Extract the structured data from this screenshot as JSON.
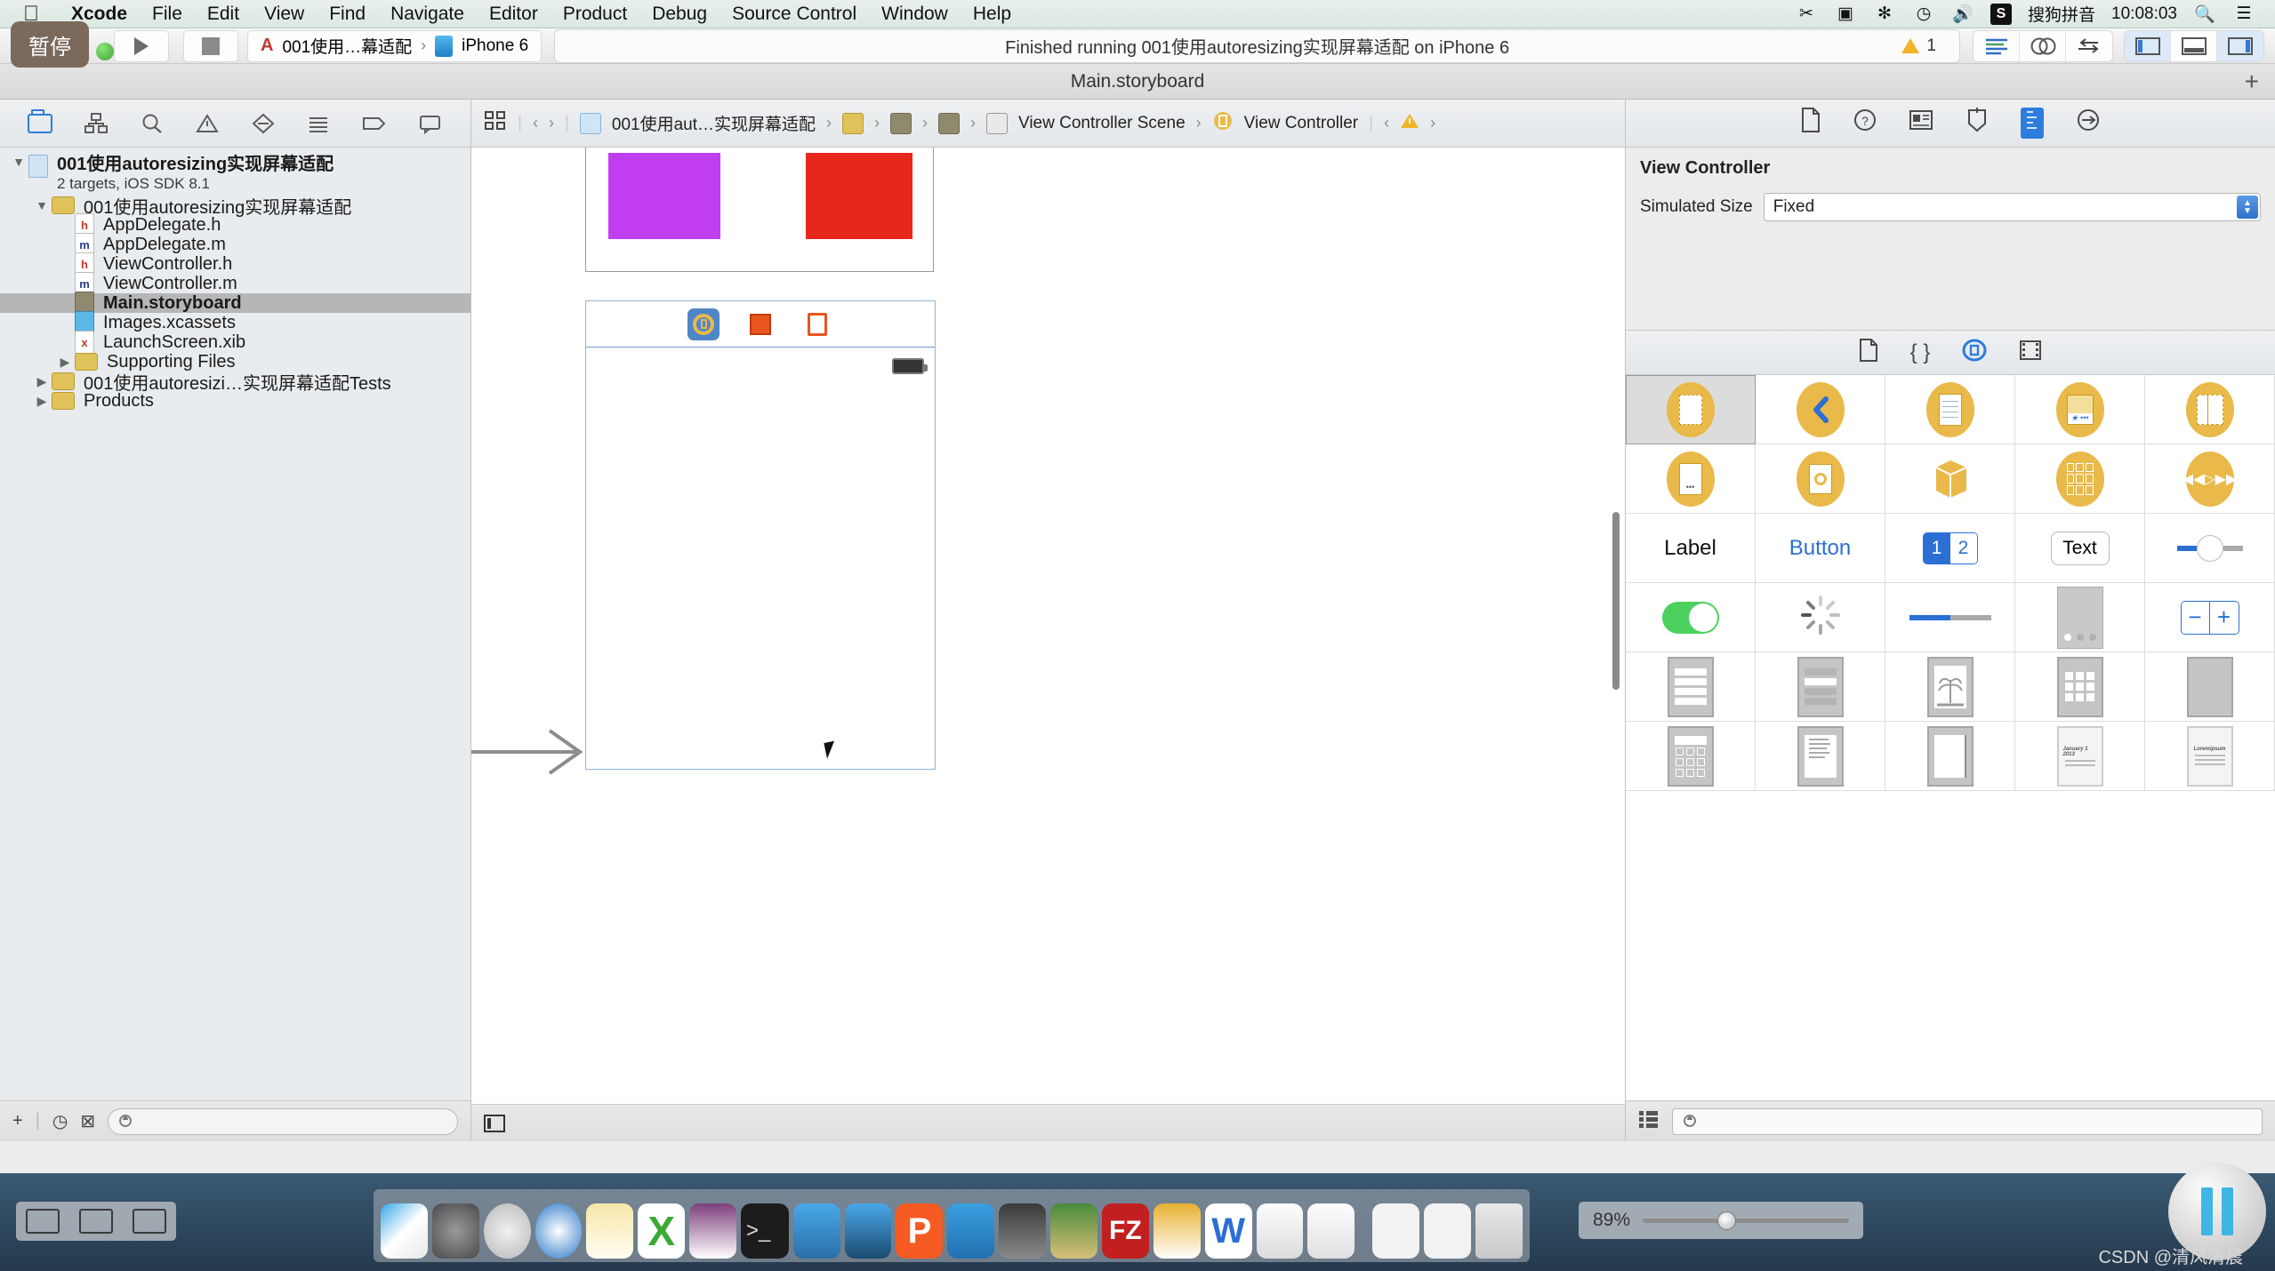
{
  "menubar": {
    "apple": "",
    "items": [
      "Xcode",
      "File",
      "Edit",
      "View",
      "Find",
      "Navigate",
      "Editor",
      "Product",
      "Debug",
      "Source Control",
      "Window",
      "Help"
    ],
    "status": {
      "scissors_icon": "✂",
      "screen_icon": "▣",
      "bluetooth_icon": "✻",
      "timemachine_icon": "◷",
      "volume_icon": "🔊",
      "input_badge": "S",
      "input_name": "搜狗拼音",
      "clock": "10:08:03",
      "search_icon": "🔍",
      "menu_icon": "☰"
    }
  },
  "toolbar": {
    "pause_label": "暂停",
    "run_tooltip": "Run",
    "stop_tooltip": "Stop",
    "scheme_project": "001使用…幕适配",
    "scheme_separator": "›",
    "scheme_destination": "iPhone 6",
    "activity_text": "Finished running 001使用autoresizing实现屏幕适配 on iPhone 6",
    "warning_count": "1",
    "editor_segments": [
      "standard-editor",
      "assistant-editor",
      "version-editor"
    ],
    "view_segments": [
      "navigator-toggle",
      "debug-area-toggle",
      "utilities-toggle"
    ]
  },
  "tabstrip": {
    "title": "Main.storyboard",
    "add_tab": "+"
  },
  "navigator": {
    "tabs": [
      "project-navigator",
      "symbol-navigator",
      "find-navigator",
      "issue-navigator",
      "test-navigator",
      "debug-navigator",
      "breakpoint-navigator",
      "report-navigator"
    ],
    "tree": [
      {
        "name": "001使用autoresizing实现屏幕适配",
        "sub": "2 targets, iOS SDK 8.1",
        "icon": "project",
        "twisty": "▼",
        "indent": 0,
        "bold": true,
        "selected": false
      },
      {
        "name": "001使用autoresizing实现屏幕适配",
        "sub": "",
        "icon": "folder",
        "twisty": "▼",
        "indent": 1,
        "bold": false,
        "selected": false
      },
      {
        "name": "AppDelegate.h",
        "sub": "",
        "icon": "h",
        "twisty": "",
        "indent": 2,
        "bold": false,
        "selected": false
      },
      {
        "name": "AppDelegate.m",
        "sub": "",
        "icon": "m",
        "twisty": "",
        "indent": 2,
        "bold": false,
        "selected": false
      },
      {
        "name": "ViewController.h",
        "sub": "",
        "icon": "h",
        "twisty": "",
        "indent": 2,
        "bold": false,
        "selected": false
      },
      {
        "name": "ViewController.m",
        "sub": "",
        "icon": "m",
        "twisty": "",
        "indent": 2,
        "bold": false,
        "selected": false
      },
      {
        "name": "Main.storyboard",
        "sub": "",
        "icon": "sb",
        "twisty": "",
        "indent": 2,
        "bold": true,
        "selected": true
      },
      {
        "name": "Images.xcassets",
        "sub": "",
        "icon": "xc",
        "twisty": "",
        "indent": 2,
        "bold": false,
        "selected": false
      },
      {
        "name": "LaunchScreen.xib",
        "sub": "",
        "icon": "xib",
        "twisty": "",
        "indent": 2,
        "bold": false,
        "selected": false
      },
      {
        "name": "Supporting Files",
        "sub": "",
        "icon": "folder",
        "twisty": "▶",
        "indent": 2,
        "bold": false,
        "selected": false
      },
      {
        "name": "001使用autoresizi…实现屏幕适配Tests",
        "sub": "",
        "icon": "folder",
        "twisty": "▶",
        "indent": 1,
        "bold": false,
        "selected": false
      },
      {
        "name": "Products",
        "sub": "",
        "icon": "folder",
        "twisty": "▶",
        "indent": 1,
        "bold": false,
        "selected": false
      }
    ],
    "footer": {
      "add": "+",
      "recent_icon": "◷",
      "unsaved_icon": "⊠",
      "filter_placeholder": ""
    }
  },
  "jumpbar": {
    "related_icon": "⊞",
    "back": "‹",
    "forward": "›",
    "crumbs": [
      {
        "label": "001使用aut…实现屏幕适配",
        "icon": "project"
      },
      {
        "label": "",
        "icon": "folder"
      },
      {
        "label": "",
        "icon": "file"
      },
      {
        "label": "",
        "icon": "file2"
      },
      {
        "label": "View Controller Scene",
        "icon": "scene"
      },
      {
        "label": "View Controller",
        "icon": "vc"
      }
    ],
    "issue_prev": "‹",
    "issue_icon": "warning",
    "issue_next": "›"
  },
  "canvas": {
    "top_scene": {
      "swatches": [
        {
          "name": "purple-square",
          "color": "#c13ef0"
        },
        {
          "name": "red-square",
          "color": "#e8271c"
        }
      ]
    },
    "bottom_scene": {
      "dock_items": [
        "view-controller-icon",
        "first-responder-icon",
        "exit-icon"
      ],
      "selected_dock_item": "view-controller-icon",
      "battery_indicator": "battery"
    },
    "segue_arrow": "→"
  },
  "utilities": {
    "inspector_tabs": [
      "file-inspector",
      "quick-help-inspector",
      "identity-inspector",
      "attributes-inspector",
      "size-inspector",
      "connections-inspector"
    ],
    "active_inspector": "size-inspector",
    "title": "View Controller",
    "simulated_size_label": "Simulated Size",
    "simulated_size_value": "Fixed",
    "library_tabs": [
      "file-template-library",
      "code-snippet-library",
      "object-library",
      "media-library"
    ],
    "active_library": "object-library",
    "objects": [
      [
        {
          "name": "view-controller",
          "kind": "oval-view",
          "selected": true
        },
        {
          "name": "navigation-controller",
          "kind": "oval-back"
        },
        {
          "name": "table-view-controller",
          "kind": "oval-lines"
        },
        {
          "name": "tab-bar-controller",
          "kind": "oval-tabbar"
        },
        {
          "name": "split-view-controller",
          "kind": "oval-split"
        }
      ],
      [
        {
          "name": "page-view-controller",
          "kind": "oval-page"
        },
        {
          "name": "gl-kit-view-controller",
          "kind": "oval-camera"
        },
        {
          "name": "object",
          "kind": "cube"
        },
        {
          "name": "collection-view-controller",
          "kind": "oval-grid"
        },
        {
          "name": "avkit-player-controller",
          "kind": "oval-player"
        }
      ],
      [
        {
          "name": "label",
          "kind": "text",
          "text": "Label"
        },
        {
          "name": "button",
          "kind": "text-blue",
          "text": "Button"
        },
        {
          "name": "segmented-control",
          "kind": "segmented",
          "text": [
            "1",
            "2"
          ]
        },
        {
          "name": "text-field",
          "kind": "textfield",
          "text": "Text"
        },
        {
          "name": "slider",
          "kind": "slider"
        }
      ],
      [
        {
          "name": "switch",
          "kind": "switch"
        },
        {
          "name": "activity-indicator",
          "kind": "spinner"
        },
        {
          "name": "progress-view",
          "kind": "progress"
        },
        {
          "name": "page-control",
          "kind": "pagecontrol"
        },
        {
          "name": "stepper",
          "kind": "stepper"
        }
      ],
      [
        {
          "name": "table-view",
          "kind": "thumb-tableview"
        },
        {
          "name": "table-view-cell",
          "kind": "thumb-tablecell"
        },
        {
          "name": "image-view",
          "kind": "thumb-imageview"
        },
        {
          "name": "collection-view",
          "kind": "thumb-collectionview"
        },
        {
          "name": "collection-reusable-view",
          "kind": "thumb-reusable"
        }
      ],
      [
        {
          "name": "text-view",
          "kind": "thumb-textview"
        },
        {
          "name": "scroll-view",
          "kind": "thumb-scrollview"
        },
        {
          "name": "picker-view",
          "kind": "thumb-pickerview"
        },
        {
          "name": "date-picker",
          "kind": "thumb-datepicker",
          "text": "January 1  2013"
        },
        {
          "name": "web-view",
          "kind": "thumb-webview",
          "text": "Loremipsum"
        }
      ]
    ],
    "footer": {
      "list_icon": "☰",
      "filter_placeholder": ""
    }
  },
  "desktop": {
    "dock_apps": [
      "finder",
      "system-preferences",
      "launchpad",
      "safari",
      "notes",
      "xcode-beta",
      "onenote",
      "terminal",
      "xcode",
      "xcode-alt",
      "pages-p",
      "snip",
      "imovie",
      "feather",
      "filezilla",
      "sketchbook",
      "word",
      "textedit",
      "preview"
    ],
    "spaces": [
      "mission-control",
      "spaces",
      "window"
    ],
    "zoom_value": "89%",
    "pause_overlay": "⏸",
    "watermark": "CSDN @清风清晨"
  }
}
